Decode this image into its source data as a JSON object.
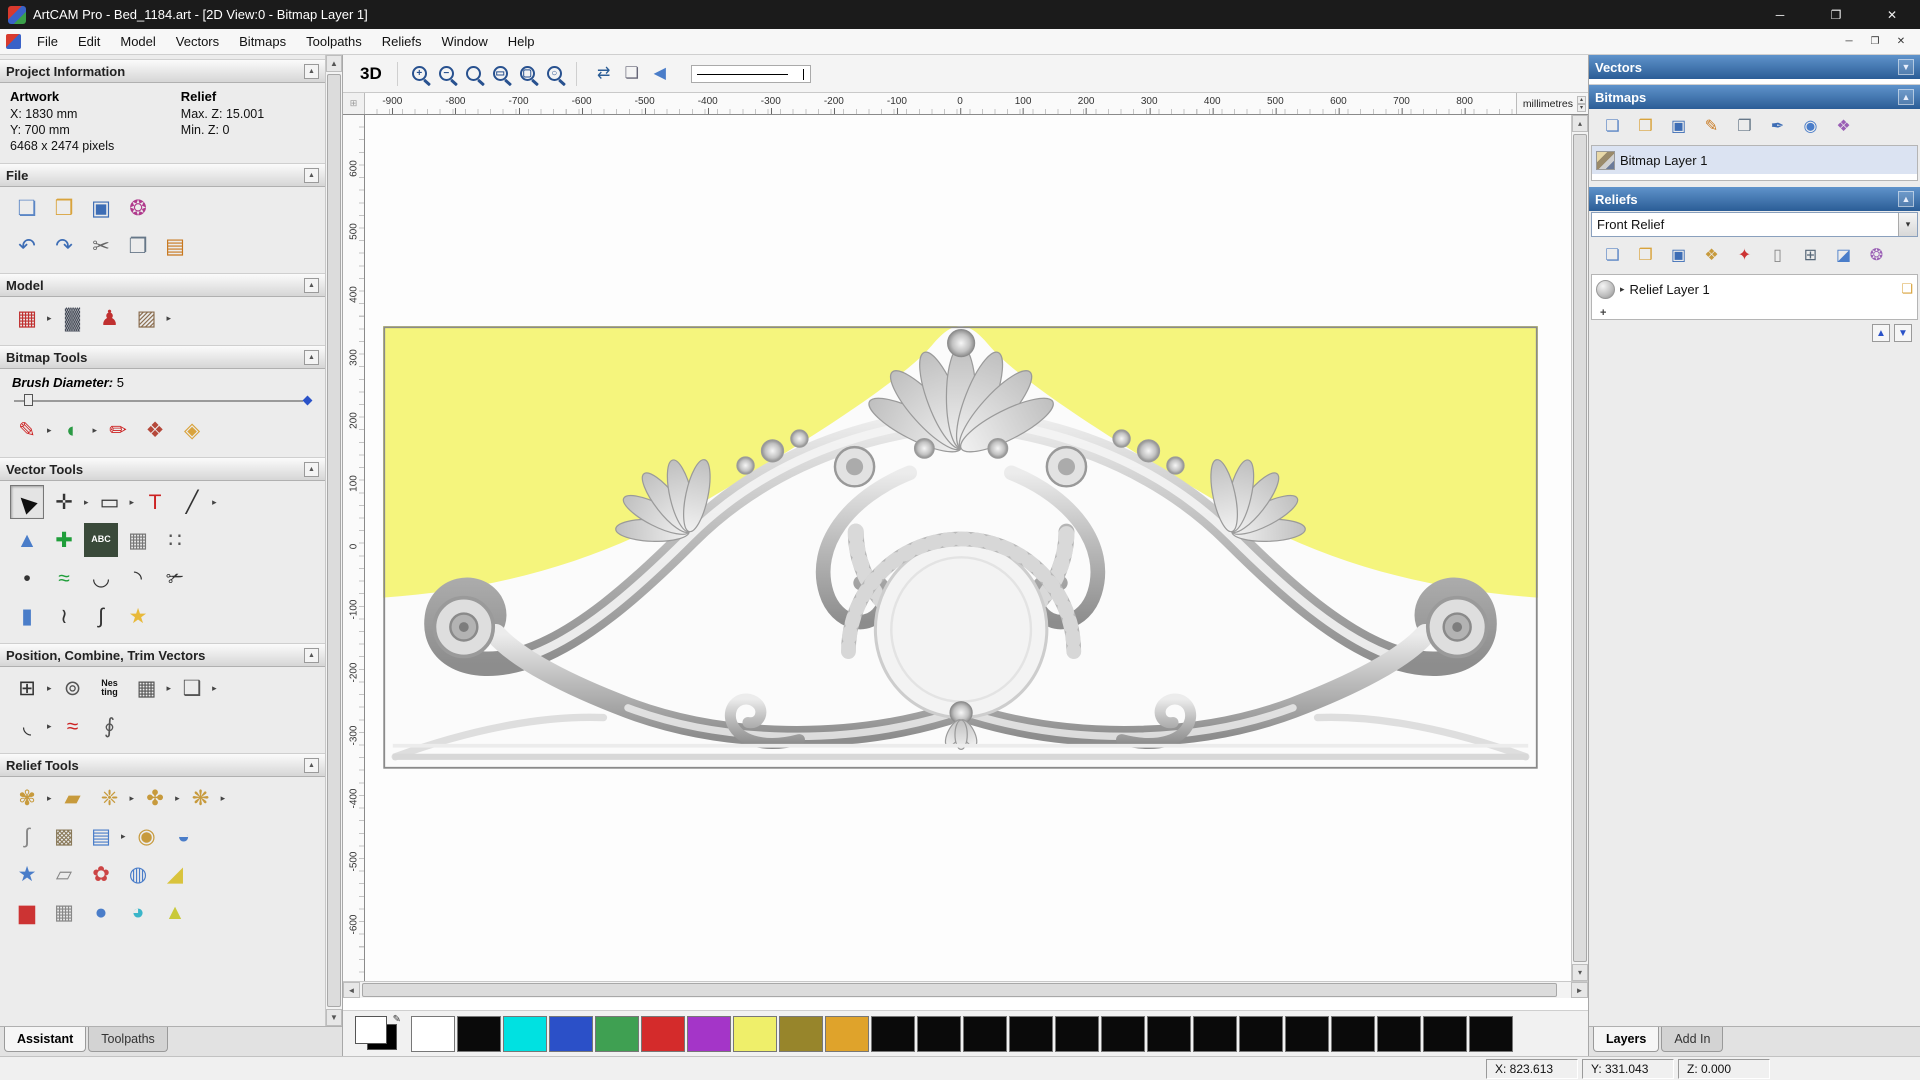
{
  "window": {
    "title": "ArtCAM Pro - Bed_1184.art - [2D View:0 - Bitmap Layer 1]",
    "controls": [
      {
        "name": "minimize-button",
        "glyph": "─"
      },
      {
        "name": "maximize-button",
        "glyph": "❐"
      },
      {
        "name": "close-button",
        "glyph": "✕"
      }
    ],
    "mdi_controls": [
      {
        "name": "mdi-minimize-button",
        "glyph": "─"
      },
      {
        "name": "mdi-restore-button",
        "glyph": "❐"
      },
      {
        "name": "mdi-close-button",
        "glyph": "✕"
      }
    ]
  },
  "menu": {
    "items": [
      "File",
      "Edit",
      "Model",
      "Vectors",
      "Bitmaps",
      "Toolpaths",
      "Reliefs",
      "Window",
      "Help"
    ]
  },
  "icons": {
    "pin": "▲",
    "dropdown": "▸",
    "combo_arrow": "▾",
    "scroll_up": "▲",
    "scroll_down": "▼",
    "scroll_left": "◄",
    "scroll_right": "►",
    "spinner_up": "▴",
    "spinner_down": "▾",
    "collapse": "▼",
    "pencil": "✎",
    "plus": "+",
    "grid_corner": "⊞",
    "move_up": "▲",
    "move_down": "▼"
  },
  "left_panel": {
    "project": {
      "title": "Project Information",
      "artwork_label": "Artwork",
      "relief_label": "Relief",
      "x": "X: 1830 mm",
      "y": "Y: 700 mm",
      "pixels": "6468 x 2474 pixels",
      "max_z": "Max. Z: 15.001",
      "min_z": "Min. Z: 0"
    },
    "file": {
      "title": "File",
      "rows": [
        [
          {
            "n": "new-model-icon",
            "g": "❏",
            "c": "#5b86c5"
          },
          {
            "n": "open-model-icon",
            "g": "❒",
            "c": "#d9a33c"
          },
          {
            "n": "save-model-icon",
            "g": "▣",
            "c": "#3d6db5"
          },
          {
            "n": "model-wizard-icon",
            "g": "❂",
            "c": "#b03a8c"
          }
        ],
        [
          {
            "n": "undo-icon",
            "g": "↶",
            "c": "#3d6db5"
          },
          {
            "n": "redo-icon",
            "g": "↷",
            "c": "#3d6db5"
          },
          {
            "n": "cut-icon",
            "g": "✂",
            "c": "#666666"
          },
          {
            "n": "copy-icon",
            "g": "❐",
            "c": "#667788"
          },
          {
            "n": "paste-icon",
            "g": "▤",
            "c": "#c8781e"
          }
        ]
      ]
    },
    "model": {
      "title": "Model",
      "rows": [
        [
          {
            "n": "set-model-size-icon",
            "g": "▦",
            "c": "#c03030",
            "dd": true
          },
          {
            "n": "adjust-model-icon",
            "g": "▓",
            "c": "#444a57"
          },
          {
            "n": "model-offset-icon",
            "g": "♟",
            "c": "#c03030"
          },
          {
            "n": "greyscale-image-icon",
            "g": "▨",
            "c": "#8a6d4f",
            "dd": true
          }
        ]
      ]
    },
    "bitmap_tools": {
      "title": "Bitmap Tools",
      "brush_label": "Brush Diameter:",
      "brush_value": "5",
      "rows": [
        [
          {
            "n": "paint-brush-icon",
            "g": "✎",
            "c": "#cc2222",
            "dd": true
          },
          {
            "n": "paint-selective-icon",
            "g": "◐",
            "c": "#2a9a44",
            "dd": true
          },
          {
            "n": "draw-icon",
            "g": "✏",
            "c": "#cc2222"
          },
          {
            "n": "colour-palette-icon",
            "g": "❖",
            "c": "#b5483a"
          },
          {
            "n": "flood-fill-icon",
            "g": "◈",
            "c": "#d9a33c"
          }
        ]
      ]
    },
    "vector_tools": {
      "title": "Vector Tools",
      "rows": [
        [
          {
            "n": "select-vectors-icon",
            "g": "◀",
            "c": "#111111",
            "rot": 45,
            "sel": true
          },
          {
            "n": "transform-vectors-icon",
            "g": "✛",
            "c": "#333333",
            "dd": true
          },
          {
            "n": "create-rectangle-icon",
            "g": "▭",
            "c": "#333333",
            "dd": true
          },
          {
            "n": "create-text-icon",
            "g": "T",
            "c": "#cc2222"
          },
          {
            "n": "create-polyline-icon",
            "g": "╱",
            "c": "#333333",
            "dd": true
          }
        ],
        [
          {
            "n": "wireframe-cone-icon",
            "g": "▲",
            "c": "#4a7dc9"
          },
          {
            "n": "paste-along-curve-icon",
            "g": "✚",
            "c": "#1f9e3a"
          },
          {
            "n": "text-abc-icon",
            "txt": "ABC",
            "bg": "#3a4a3a",
            "c": "#ffffff"
          },
          {
            "n": "fence-icon",
            "g": "▦",
            "c": "#777777"
          },
          {
            "n": "point-array-icon",
            "g": "∷",
            "c": "#555555"
          }
        ],
        [
          {
            "n": "create-point-icon",
            "g": "•",
            "c": "#333333"
          },
          {
            "n": "free-spline-icon",
            "g": "≈",
            "c": "#1f9e3a"
          },
          {
            "n": "bezier-curve-icon",
            "g": "◡",
            "c": "#333333"
          },
          {
            "n": "arc-icon",
            "g": "◝",
            "c": "#333333"
          },
          {
            "n": "trim-vectors-icon",
            "g": "✃",
            "c": "#333333"
          }
        ],
        [
          {
            "n": "extrude-icon",
            "g": "▮",
            "c": "#4a7dc9"
          },
          {
            "n": "node-editing-icon",
            "g": "≀",
            "c": "#333333"
          },
          {
            "n": "join-vectors-icon",
            "g": "∫",
            "c": "#333333"
          },
          {
            "n": "magic-wand-icon",
            "g": "★",
            "c": "#e8b93a"
          }
        ]
      ]
    },
    "position_tools": {
      "title": "Position, Combine, Trim Vectors",
      "rows": [
        [
          {
            "n": "align-objects-icon",
            "g": "⊞",
            "c": "#333333",
            "dd": true
          },
          {
            "n": "circular-copy-icon",
            "g": "⊚",
            "c": "#555555"
          },
          {
            "n": "nesting-icon",
            "txt": "Nes ting",
            "c": "#111111"
          },
          {
            "n": "block-copy-icon",
            "g": "▦",
            "c": "#555555",
            "dd": true
          },
          {
            "n": "weld-vectors-icon",
            "g": "❑",
            "c": "#555555",
            "dd": true
          }
        ],
        [
          {
            "n": "fillet-tool-icon",
            "g": "◟",
            "c": "#333333",
            "dd": true
          },
          {
            "n": "slice-vectors-icon",
            "g": "≈",
            "c": "#cc2222"
          },
          {
            "n": "spiral-icon",
            "g": "∮",
            "c": "#555555"
          }
        ]
      ]
    },
    "relief_tools": {
      "title": "Relief Tools",
      "rows": [
        [
          {
            "n": "sculpting-icon",
            "g": "✾",
            "c": "#c79a3c",
            "dd": true
          },
          {
            "n": "smoothing-icon",
            "g": "▰",
            "c": "#c79a3c"
          },
          {
            "n": "deform-relief-icon",
            "g": "❈",
            "c": "#c79a3c",
            "dd": true
          },
          {
            "n": "emboss-icon",
            "g": "✤",
            "c": "#c79a3c",
            "dd": true
          },
          {
            "n": "carve-icon",
            "g": "❋",
            "c": "#c79a3c",
            "dd": true
          }
        ],
        [
          {
            "n": "sweep-profile-icon",
            "g": "∫",
            "c": "#888888"
          },
          {
            "n": "weave-wizard-icon",
            "g": "▩",
            "c": "#8a7a5a"
          },
          {
            "n": "relief-clipart-icon",
            "g": "▤",
            "c": "#4a7dc9",
            "dd": true
          },
          {
            "n": "turn-wizard-icon",
            "g": "◉",
            "c": "#c79a3c"
          },
          {
            "n": "dome-icon",
            "g": "◒",
            "c": "#4a7dc9"
          }
        ],
        [
          {
            "n": "star-wizard-icon",
            "g": "★",
            "c": "#4a7dc9"
          },
          {
            "n": "envelope-icon",
            "g": "▱",
            "c": "#888888"
          },
          {
            "n": "fan-relief-icon",
            "g": "✿",
            "c": "#cc4444"
          },
          {
            "n": "texture-relief-icon",
            "g": "◍",
            "c": "#4a7dc9"
          },
          {
            "n": "angled-plane-icon",
            "g": "◢",
            "c": "#d9c33c"
          }
        ],
        [
          {
            "n": "relief-tool-extra-1-icon",
            "g": "▆",
            "c": "#cc3333"
          },
          {
            "n": "relief-tool-extra-2-icon",
            "g": "▦",
            "c": "#888888"
          },
          {
            "n": "relief-tool-extra-3-icon",
            "g": "●",
            "c": "#4a7dc9"
          },
          {
            "n": "relief-tool-extra-4-icon",
            "g": "◕",
            "c": "#3ab5c9"
          },
          {
            "n": "relief-tool-extra-5-icon",
            "g": "▲",
            "c": "#c9c93a"
          }
        ]
      ]
    },
    "tabs": [
      {
        "label": "Assistant",
        "active": true
      },
      {
        "label": "Toolpaths",
        "active": false
      }
    ]
  },
  "toolbar": {
    "view_3d": "3D",
    "zoom_icons": [
      {
        "name": "zoom-in-icon",
        "sign": "+"
      },
      {
        "name": "zoom-out-icon",
        "sign": "−"
      },
      {
        "name": "zoom-previous-icon",
        "sign": ""
      },
      {
        "name": "zoom-rect-icon",
        "sign": "▭"
      },
      {
        "name": "zoom-fit-icon",
        "sign": "▢"
      },
      {
        "name": "zoom-object-icon",
        "sign": "○"
      }
    ],
    "view_icons": [
      {
        "n": "toggle-2d3d-icon",
        "g": "⇄",
        "c": "#2b5d96"
      },
      {
        "n": "preview-page-icon",
        "g": "❏",
        "c": "#666677"
      },
      {
        "n": "previous-view-icon",
        "g": "◀",
        "c": "#4a7dc9"
      }
    ]
  },
  "canvas": {
    "bg_color": "#f5f57d",
    "unit": "millimetres",
    "h_ruler_labels": [
      "-900",
      "-800",
      "-700",
      "-600",
      "-500",
      "-400",
      "-300",
      "-200",
      "-100",
      "0",
      "100",
      "200",
      "300",
      "400",
      "500",
      "600",
      "700",
      "800"
    ],
    "v_ruler_labels": [
      "600",
      "500",
      "400",
      "300",
      "200",
      "100",
      "0",
      "-100",
      "-200",
      "-300",
      "-400",
      "-500",
      "-600"
    ]
  },
  "palette": {
    "colors": [
      "#ffffff",
      "#0a0a0a",
      "#00e1e1",
      "#2b50c8",
      "#3fa052",
      "#d42b2b",
      "#a435c8",
      "#efef6a",
      "#97852b",
      "#dfa32b",
      "#0a0a0a",
      "#0a0a0a",
      "#0a0a0a",
      "#0a0a0a",
      "#0a0a0a",
      "#0a0a0a",
      "#0a0a0a",
      "#0a0a0a",
      "#0a0a0a",
      "#0a0a0a",
      "#0a0a0a",
      "#0a0a0a",
      "#0a0a0a",
      "#0a0a0a"
    ]
  },
  "right_panel": {
    "vectors": {
      "title": "Vectors"
    },
    "bitmaps": {
      "title": "Bitmaps",
      "toolbar": [
        {
          "n": "new-bitmap-layer-icon",
          "g": "❏",
          "c": "#5b86c5"
        },
        {
          "n": "open-bitmap-layer-icon",
          "g": "❒",
          "c": "#d9a33c"
        },
        {
          "n": "save-bitmap-layer-icon",
          "g": "▣",
          "c": "#3d6db5"
        },
        {
          "n": "paint-bitmap-icon",
          "g": "✎",
          "c": "#c8781e"
        },
        {
          "n": "merge-bitmap-icon",
          "g": "❐",
          "c": "#667788"
        },
        {
          "n": "bitmap-to-vector-icon",
          "g": "✒",
          "c": "#3d6db5"
        },
        {
          "n": "toggle-bitmap-icon",
          "g": "◉",
          "c": "#4a7dc9"
        },
        {
          "n": "bitmap-options-icon",
          "g": "❖",
          "c": "#9a5fb5"
        }
      ],
      "layer": {
        "label": "Bitmap Layer 1"
      }
    },
    "reliefs": {
      "title": "Reliefs",
      "selected": "Front Relief",
      "toolbar": [
        {
          "n": "new-relief-layer-icon",
          "g": "❏",
          "c": "#5b86c5"
        },
        {
          "n": "open-relief-layer-icon",
          "g": "❒",
          "c": "#d9a33c"
        },
        {
          "n": "save-relief-layer-icon",
          "g": "▣",
          "c": "#3d6db5"
        },
        {
          "n": "relief-library-icon",
          "g": "❖",
          "c": "#c79a3c"
        },
        {
          "n": "smooth-layer-icon",
          "g": "✦",
          "c": "#cc3333"
        },
        {
          "n": "blank-relief-icon",
          "g": "▯",
          "c": "#888888"
        },
        {
          "n": "calculate-relief-icon",
          "g": "⊞",
          "c": "#556677"
        },
        {
          "n": "erase-relief-icon",
          "g": "◪",
          "c": "#4a7dc9"
        },
        {
          "n": "relief-options-icon",
          "g": "❂",
          "c": "#9a5fb5"
        }
      ],
      "layer": {
        "label": "Relief Layer 1",
        "row_icon": "❏"
      }
    },
    "tabs": [
      {
        "label": "Layers",
        "active": true
      },
      {
        "label": "Add In",
        "active": false
      }
    ]
  },
  "status": {
    "cells": [
      {
        "name": "cursor-x",
        "text": "X: 823.613"
      },
      {
        "name": "cursor-y",
        "text": "Y: 331.043"
      },
      {
        "name": "cursor-z",
        "text": "Z: 0.000"
      }
    ]
  }
}
